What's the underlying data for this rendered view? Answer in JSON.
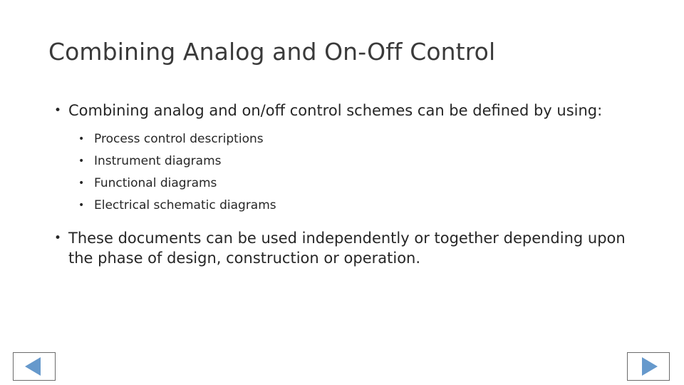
{
  "slide": {
    "title": "Combining Analog and On-Off Control",
    "bullets": [
      {
        "level": 1,
        "text": "Combining analog and on/off control schemes can be defined by using:",
        "marker": "•"
      },
      {
        "level": 2,
        "text": "Process control descriptions",
        "marker": "•"
      },
      {
        "level": 2,
        "text": "Instrument diagrams",
        "marker": "•"
      },
      {
        "level": 2,
        "text": "Functional diagrams",
        "marker": "•"
      },
      {
        "level": 2,
        "text": "Electrical schematic diagrams",
        "marker": "•"
      },
      {
        "level": 1,
        "text": "These documents can be used independently or together depending upon the phase of design, construction or operation.",
        "marker": "•"
      }
    ]
  },
  "nav": {
    "prev_label": "previous-slide",
    "next_label": "next-slide",
    "accent_color": "#6699cc",
    "border_color": "#6b6b6b"
  }
}
